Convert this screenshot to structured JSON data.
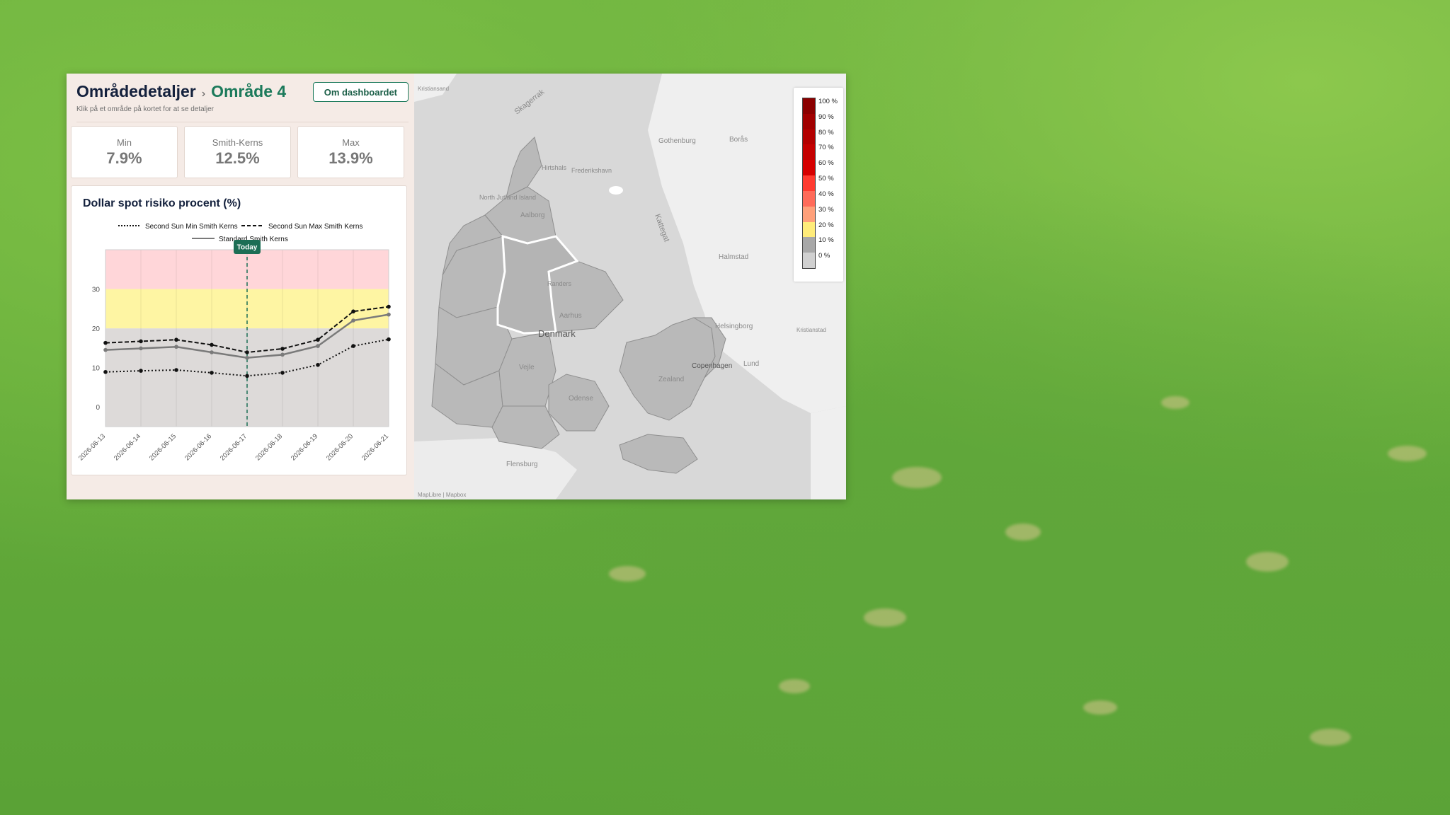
{
  "header": {
    "title": "Områdedetaljer",
    "separator": "›",
    "area_name": "Område 4",
    "subtitle": "Klik på et område på kortet for at se detaljer",
    "about_button": "Om dashboardet"
  },
  "stats": [
    {
      "label": "Min",
      "value": "7.9%"
    },
    {
      "label": "Smith-Kerns",
      "value": "12.5%"
    },
    {
      "label": "Max",
      "value": "13.9%"
    }
  ],
  "chart_title": "Dollar spot risiko procent (%)",
  "chart_data": {
    "type": "line",
    "title": "Dollar spot risiko procent (%)",
    "categories": [
      "2026-06-13",
      "2026-06-14",
      "2026-06-15",
      "2026-06-16",
      "2026-06-17",
      "2026-06-18",
      "2026-06-19",
      "2026-06-20",
      "2026-06-21"
    ],
    "series": [
      {
        "name": "Second Sun Min Smith Kerns",
        "style": "dotted",
        "color": "#111111",
        "values": [
          8.9,
          9.2,
          9.4,
          8.7,
          7.9,
          8.7,
          10.7,
          15.5,
          17.2
        ]
      },
      {
        "name": "Second Sun Max Smith Kerns",
        "style": "dashed",
        "color": "#111111",
        "values": [
          16.3,
          16.7,
          17.1,
          15.8,
          13.9,
          14.8,
          17.1,
          24.3,
          25.5
        ]
      },
      {
        "name": "Standard Smith Kerns",
        "style": "solid",
        "color": "#7a7a7a",
        "values": [
          14.5,
          14.9,
          15.3,
          13.9,
          12.5,
          13.3,
          15.5,
          22.0,
          23.5
        ]
      }
    ],
    "bands": [
      {
        "from": -5,
        "to": 20,
        "color": "#dddad9"
      },
      {
        "from": 20,
        "to": 30,
        "color": "#fef5a3"
      },
      {
        "from": 30,
        "to": 40,
        "color": "#ffd6d9"
      }
    ],
    "yticks": [
      "0",
      "10",
      "20",
      "30"
    ],
    "ylim": [
      -5,
      40
    ],
    "today_index": 4,
    "today_label": "Today",
    "legend_position": "top"
  },
  "map": {
    "labels": {
      "skagerrak": "Skagerrak",
      "kattegat": "Kattegat",
      "denmark": "Denmark",
      "gothenburg": "Gothenburg",
      "boras": "Borås",
      "halmstad": "Halmstad",
      "helsingborg": "Helsingborg",
      "copenhagen": "Copenhagen",
      "lund": "Lund",
      "odense": "Odense",
      "aalborg": "Aalborg",
      "aarhus": "Aarhus",
      "flensburg": "Flensburg",
      "vejle": "Vejle",
      "zealand": "Zealand",
      "north_jutland": "North Jutland Island",
      "hirtshals": "Hirtshals",
      "frederikshavn": "Frederikshavn",
      "randers": "Randers",
      "kristianstad": "Kristianstad",
      "kristiansand": "Kristiansand",
      "attribution": "MapLibre | Mapbox"
    },
    "legend": [
      "100 %",
      "90 %",
      "80 %",
      "70 %",
      "60 %",
      "50 %",
      "40 %",
      "30 %",
      "20 %",
      "10 %",
      "0 %"
    ],
    "legend_colors": [
      "#8b0000",
      "#a10000",
      "#b30000",
      "#c40000",
      "#d60000",
      "#ff3b30",
      "#ff6b5a",
      "#ffa07a",
      "#ffec7a",
      "#a8a8a8",
      "#d0d0d0"
    ],
    "highlight_color": "#ffffff"
  }
}
